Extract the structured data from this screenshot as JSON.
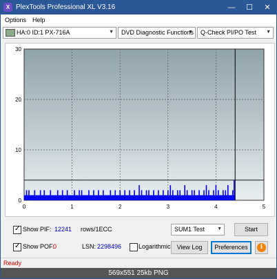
{
  "window": {
    "title": "PlexTools Professional XL V3.16",
    "icon_label": "X"
  },
  "menu": {
    "options": "Options",
    "help": "Help"
  },
  "toolbar": {
    "drive": "HA:0 ID:1  PX-716A",
    "function": "DVD Diagnostic Functions",
    "test": "Q-Check PI/PO Test"
  },
  "chart_data": {
    "type": "bar",
    "x_ticks": [
      "0",
      "1",
      "2",
      "3",
      "4",
      "5"
    ],
    "y_ticks": [
      "0",
      "10",
      "20",
      "30"
    ],
    "xlim": [
      0,
      5
    ],
    "ylim": [
      0,
      30
    ],
    "grid": true,
    "pif_threshold": 4,
    "scan_end": 4.4,
    "end_marker": 4.4,
    "series": [
      {
        "color": "#0000ff",
        "x": [
          0.02,
          0.05,
          0.08,
          0.1,
          0.14,
          0.18,
          0.22,
          0.26,
          0.3,
          0.34,
          0.38,
          0.42,
          0.46,
          0.5,
          0.55,
          0.6,
          0.65,
          0.7,
          0.75,
          0.8,
          0.85,
          0.9,
          0.95,
          1.0,
          1.05,
          1.1,
          1.15,
          1.2,
          1.25,
          1.3,
          1.35,
          1.4,
          1.45,
          1.5,
          1.55,
          1.6,
          1.65,
          1.7,
          1.75,
          1.8,
          1.85,
          1.9,
          1.95,
          2.0,
          2.05,
          2.1,
          2.15,
          2.2,
          2.25,
          2.3,
          2.35,
          2.4,
          2.45,
          2.5,
          2.55,
          2.6,
          2.65,
          2.7,
          2.75,
          2.8,
          2.85,
          2.9,
          2.95,
          3.0,
          3.05,
          3.1,
          3.15,
          3.2,
          3.25,
          3.3,
          3.35,
          3.4,
          3.45,
          3.5,
          3.55,
          3.6,
          3.65,
          3.7,
          3.75,
          3.8,
          3.85,
          3.9,
          3.95,
          4.0,
          4.05,
          4.1,
          4.15,
          4.2,
          4.25,
          4.3,
          4.35,
          4.38
        ],
        "y": [
          1,
          2,
          1,
          2,
          1,
          1,
          2,
          1,
          1,
          2,
          1,
          2,
          1,
          1,
          2,
          1,
          1,
          2,
          1,
          2,
          1,
          2,
          1,
          1,
          2,
          1,
          2,
          2,
          1,
          1,
          2,
          1,
          2,
          1,
          2,
          1,
          2,
          1,
          1,
          2,
          1,
          2,
          1,
          2,
          1,
          2,
          1,
          2,
          1,
          2,
          1,
          3,
          2,
          1,
          2,
          2,
          1,
          2,
          1,
          2,
          1,
          2,
          1,
          2,
          3,
          2,
          1,
          2,
          2,
          1,
          3,
          2,
          1,
          2,
          2,
          1,
          2,
          1,
          2,
          3,
          2,
          1,
          2,
          3,
          2,
          1,
          2,
          2,
          3,
          1,
          2,
          4
        ]
      }
    ]
  },
  "controls": {
    "show_pif_label": "Show PIF:",
    "pif_value": "12241",
    "pif_unit": "rows/1ECC",
    "show_pof_label": "Show POF:",
    "pof_value": "0",
    "lsn_label": "LSN:",
    "lsn_value": "2298496",
    "logarithmic_label": "Logarithmic",
    "sum_select": "SUM1 Test",
    "start_label": "Start",
    "view_log_label": "View Log",
    "preferences_label": "Preferences",
    "info_label": "i"
  },
  "status": {
    "text": "Ready"
  },
  "footer": {
    "text": "569x551  25kb  PNG"
  },
  "colors": {
    "titlebar": "#2b5797",
    "plot_bg_top": "#8fa3ab",
    "plot_bg_bottom": "#e8eef0",
    "bar": "#0000ff",
    "status": "#e00000"
  }
}
